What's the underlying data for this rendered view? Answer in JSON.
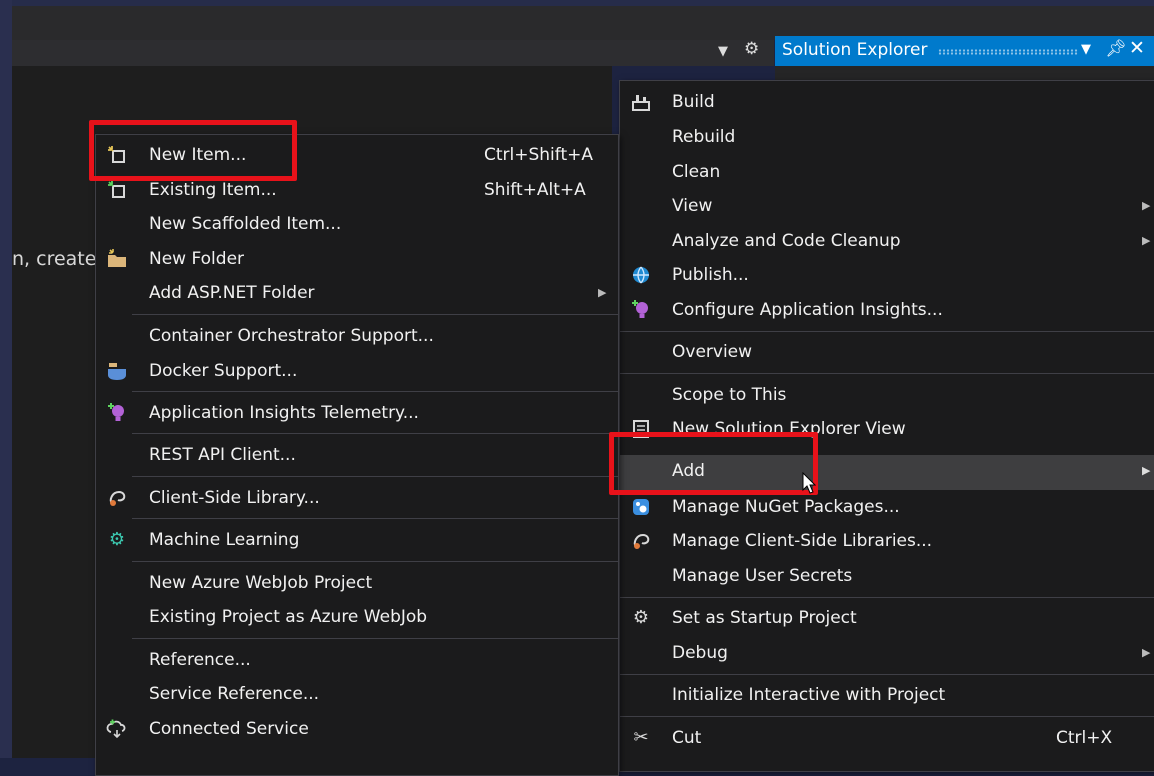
{
  "editor": {
    "text": "n, create"
  },
  "solution_explorer": {
    "title": "Solution Explorer",
    "dropdown_icon": "dropdown-triangle-icon",
    "pin_icon": "pin-icon",
    "close_icon": "close-icon"
  },
  "toolbar": {
    "dropdown_icon": "dropdown-triangle-icon",
    "gear_icon": "gear-icon"
  },
  "add_submenu": {
    "items": [
      {
        "label": "New Item...",
        "shortcut": "Ctrl+Shift+A",
        "icon": "new-item-icon",
        "highlighted_with_box": true
      },
      {
        "label": "Existing Item...",
        "shortcut": "Shift+Alt+A",
        "icon": "existing-item-icon"
      },
      {
        "label": "New Scaffolded Item..."
      },
      {
        "label": "New Folder",
        "icon": "new-folder-icon"
      },
      {
        "label": "Add ASP.NET Folder",
        "submenu": true
      },
      {
        "label": "Container Orchestrator Support..."
      },
      {
        "label": "Docker Support...",
        "icon": "docker-icon"
      },
      {
        "label": "Application Insights Telemetry...",
        "icon": "app-insights-icon"
      },
      {
        "label": "REST API Client..."
      },
      {
        "label": "Client-Side Library...",
        "icon": "client-library-icon"
      },
      {
        "label": "Machine Learning",
        "icon": "machine-learning-icon"
      },
      {
        "label": "New Azure WebJob Project"
      },
      {
        "label": "Existing Project as Azure WebJob"
      },
      {
        "label": "Reference..."
      },
      {
        "label": "Service Reference..."
      },
      {
        "label": "Connected Service",
        "icon": "connected-service-icon"
      }
    ]
  },
  "context_menu": {
    "items": [
      {
        "label": "Build",
        "icon": "build-icon"
      },
      {
        "label": "Rebuild"
      },
      {
        "label": "Clean"
      },
      {
        "label": "View",
        "submenu": true
      },
      {
        "label": "Analyze and Code Cleanup",
        "submenu": true
      },
      {
        "label": "Publish...",
        "icon": "publish-globe-icon"
      },
      {
        "label": "Configure Application Insights...",
        "icon": "app-insights-icon"
      },
      {
        "label": "Overview"
      },
      {
        "label": "Scope to This"
      },
      {
        "label": "New Solution Explorer View",
        "icon": "new-view-icon"
      },
      {
        "label": "Add",
        "submenu": true,
        "selected": true,
        "highlighted_with_box": true
      },
      {
        "label": "Manage NuGet Packages...",
        "icon": "nuget-icon"
      },
      {
        "label": "Manage Client-Side Libraries...",
        "icon": "client-library-icon"
      },
      {
        "label": "Manage User Secrets"
      },
      {
        "label": "Set as Startup Project",
        "icon": "gear-icon"
      },
      {
        "label": "Debug",
        "submenu": true
      },
      {
        "label": "Initialize Interactive with Project"
      },
      {
        "label": "Cut",
        "shortcut": "Ctrl+X",
        "icon": "scissors-icon"
      }
    ]
  },
  "colors": {
    "accent": "#007acc",
    "annotation_box": "#e8121a",
    "menu_bg": "#1b1b1c",
    "selected_bg": "#3e3e40"
  }
}
